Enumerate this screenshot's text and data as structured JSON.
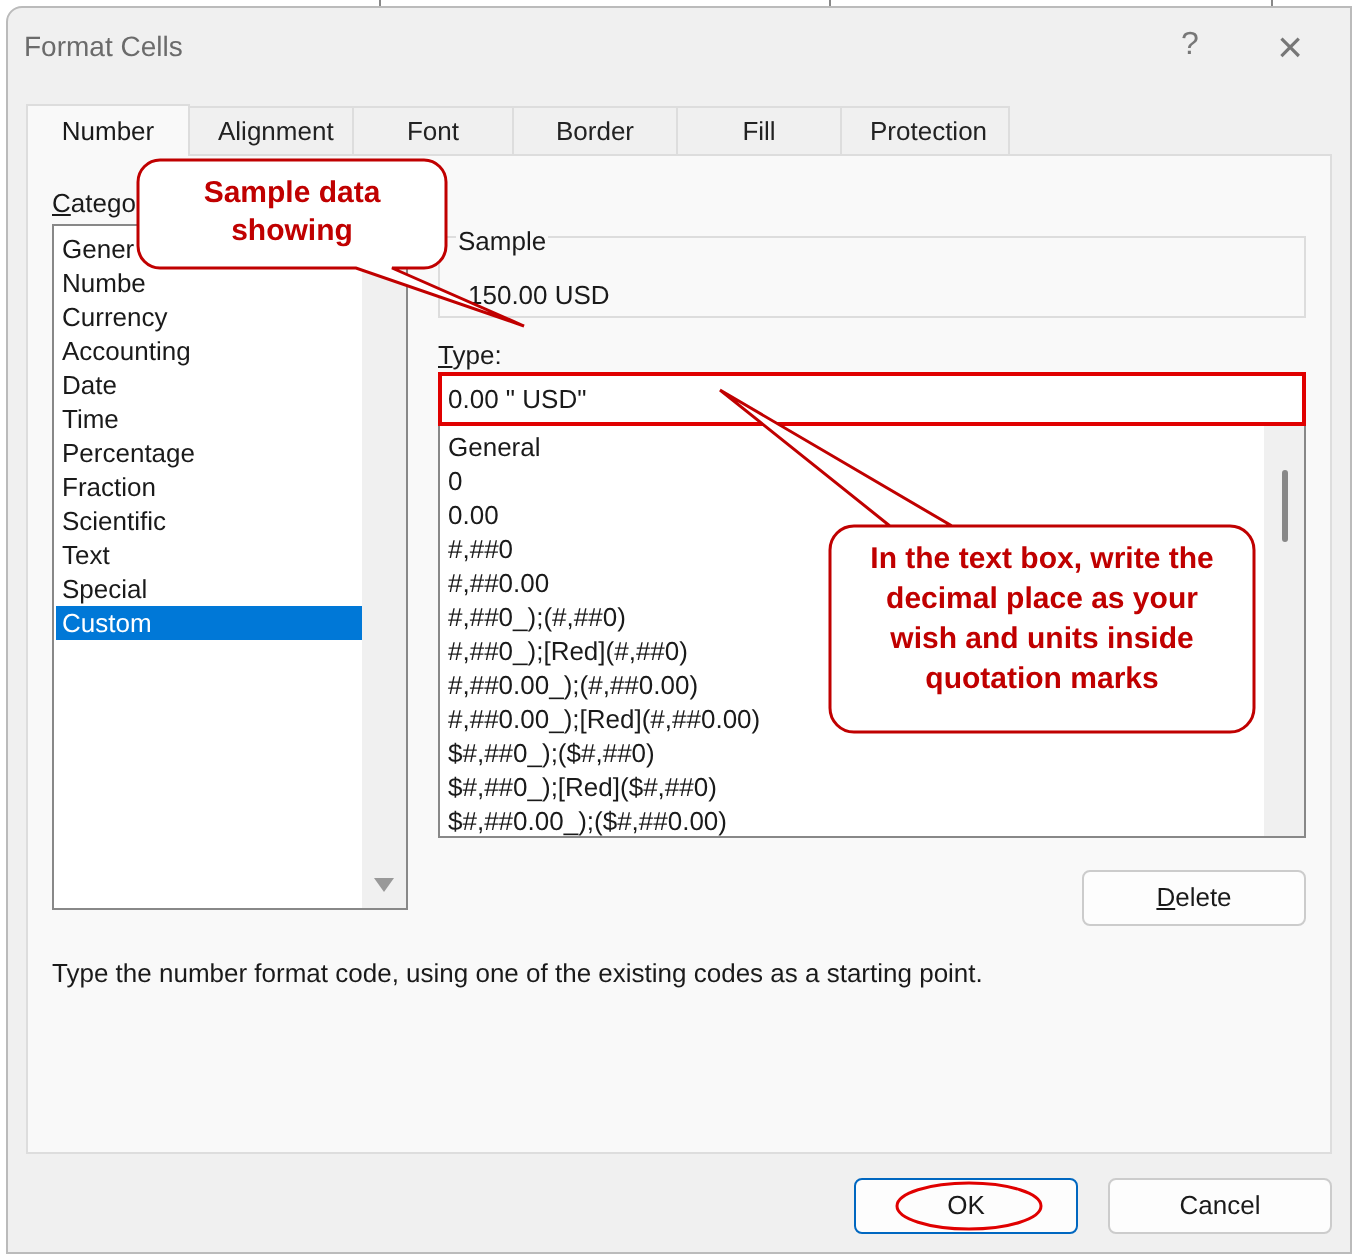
{
  "window": {
    "title": "Format Cells",
    "help": "?",
    "close": "×"
  },
  "tabs": [
    {
      "label": "Number",
      "selected": true
    },
    {
      "label": "Alignment",
      "selected": false
    },
    {
      "label": "Font",
      "selected": false
    },
    {
      "label": "Border",
      "selected": false
    },
    {
      "label": "Fill",
      "selected": false
    },
    {
      "label": "Protection",
      "selected": false
    }
  ],
  "category": {
    "label": "Catego",
    "items": [
      {
        "label": "Gener",
        "selected": false
      },
      {
        "label": "Numbe",
        "selected": false
      },
      {
        "label": "Currency",
        "selected": false
      },
      {
        "label": "Accounting",
        "selected": false
      },
      {
        "label": "Date",
        "selected": false
      },
      {
        "label": "Time",
        "selected": false
      },
      {
        "label": "Percentage",
        "selected": false
      },
      {
        "label": "Fraction",
        "selected": false
      },
      {
        "label": "Scientific",
        "selected": false
      },
      {
        "label": "Text",
        "selected": false
      },
      {
        "label": "Special",
        "selected": false
      },
      {
        "label": "Custom",
        "selected": true
      }
    ]
  },
  "sample": {
    "label": "Sample",
    "value": "150.00  USD"
  },
  "type": {
    "label": "Type:",
    "value": "0.00 \" USD\"",
    "codes": [
      "General",
      "0",
      "0.00",
      "#,##0",
      "#,##0.00",
      "#,##0_);(#,##0)",
      "#,##0_);[Red](#,##0)",
      "#,##0.00_);(#,##0.00)",
      "#,##0.00_);[Red](#,##0.00)",
      "$#,##0_);($#,##0)",
      "$#,##0_);[Red]($#,##0)",
      "$#,##0.00_);($#,##0.00)"
    ]
  },
  "delete_button": "Delete",
  "description": "Type the number format code, using one of the existing codes as a starting point.",
  "buttons": [
    {
      "label": "OK",
      "default": true,
      "circled": true
    },
    {
      "label": "Cancel",
      "default": false,
      "circled": false
    }
  ],
  "callouts": [
    {
      "text": "Sample data showing"
    },
    {
      "text": "In the text box, write the decimal place as your wish and units inside quotation  marks"
    }
  ]
}
